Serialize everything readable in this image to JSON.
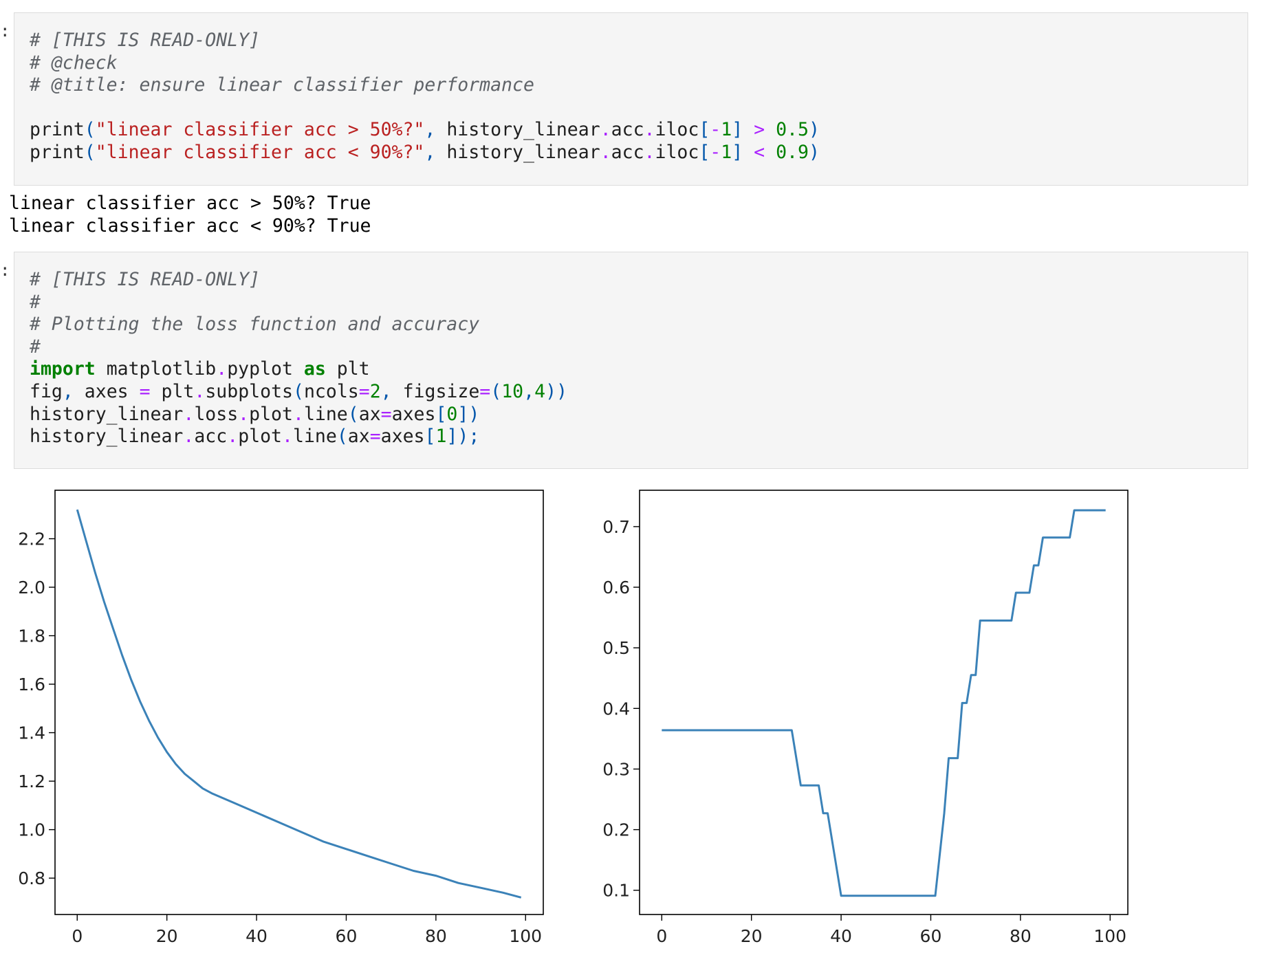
{
  "cells": [
    {
      "lines": [
        [
          {
            "t": "# [THIS IS READ-ONLY]",
            "c": "cm"
          }
        ],
        [
          {
            "t": "# @check",
            "c": "cm"
          }
        ],
        [
          {
            "t": "# @title: ensure linear classifier performance",
            "c": "cm"
          }
        ],
        [],
        [
          {
            "t": "print",
            "c": ""
          },
          {
            "t": "(",
            "c": "pun"
          },
          {
            "t": "\"linear classifier acc > 50%?\"",
            "c": "str"
          },
          {
            "t": ",",
            "c": "pun"
          },
          {
            "t": " history_linear",
            "c": ""
          },
          {
            "t": ".",
            "c": "op"
          },
          {
            "t": "acc",
            "c": ""
          },
          {
            "t": ".",
            "c": "op"
          },
          {
            "t": "iloc",
            "c": ""
          },
          {
            "t": "[",
            "c": "pun"
          },
          {
            "t": "-",
            "c": "op"
          },
          {
            "t": "1",
            "c": "num"
          },
          {
            "t": "]",
            "c": "pun"
          },
          {
            "t": " > ",
            "c": "op"
          },
          {
            "t": "0.5",
            "c": "num"
          },
          {
            "t": ")",
            "c": "pun"
          }
        ],
        [
          {
            "t": "print",
            "c": ""
          },
          {
            "t": "(",
            "c": "pun"
          },
          {
            "t": "\"linear classifier acc < 90%?\"",
            "c": "str"
          },
          {
            "t": ",",
            "c": "pun"
          },
          {
            "t": " history_linear",
            "c": ""
          },
          {
            "t": ".",
            "c": "op"
          },
          {
            "t": "acc",
            "c": ""
          },
          {
            "t": ".",
            "c": "op"
          },
          {
            "t": "iloc",
            "c": ""
          },
          {
            "t": "[",
            "c": "pun"
          },
          {
            "t": "-",
            "c": "op"
          },
          {
            "t": "1",
            "c": "num"
          },
          {
            "t": "]",
            "c": "pun"
          },
          {
            "t": " < ",
            "c": "op"
          },
          {
            "t": "0.9",
            "c": "num"
          },
          {
            "t": ")",
            "c": "pun"
          }
        ]
      ],
      "output": [
        "linear classifier acc > 50%? True",
        "linear classifier acc < 90%? True"
      ]
    },
    {
      "lines": [
        [
          {
            "t": "# [THIS IS READ-ONLY]",
            "c": "cm"
          }
        ],
        [
          {
            "t": "#",
            "c": "cm"
          }
        ],
        [
          {
            "t": "# Plotting the loss function and accuracy",
            "c": "cm"
          }
        ],
        [
          {
            "t": "#",
            "c": "cm"
          }
        ],
        [
          {
            "t": "import",
            "c": "kw"
          },
          {
            "t": " matplotlib",
            "c": ""
          },
          {
            "t": ".",
            "c": "op"
          },
          {
            "t": "pyplot ",
            "c": ""
          },
          {
            "t": "as",
            "c": "kw"
          },
          {
            "t": " plt",
            "c": ""
          }
        ],
        [
          {
            "t": "fig",
            "c": ""
          },
          {
            "t": ",",
            "c": "pun"
          },
          {
            "t": " axes ",
            "c": ""
          },
          {
            "t": "=",
            "c": "op"
          },
          {
            "t": " plt",
            "c": ""
          },
          {
            "t": ".",
            "c": "op"
          },
          {
            "t": "subplots",
            "c": ""
          },
          {
            "t": "(",
            "c": "pun"
          },
          {
            "t": "ncols",
            "c": ""
          },
          {
            "t": "=",
            "c": "op"
          },
          {
            "t": "2",
            "c": "num"
          },
          {
            "t": ",",
            "c": "pun"
          },
          {
            "t": " figsize",
            "c": ""
          },
          {
            "t": "=",
            "c": "op"
          },
          {
            "t": "(",
            "c": "pun"
          },
          {
            "t": "10",
            "c": "num"
          },
          {
            "t": ",",
            "c": "pun"
          },
          {
            "t": "4",
            "c": "num"
          },
          {
            "t": "))",
            "c": "pun"
          }
        ],
        [
          {
            "t": "history_linear",
            "c": ""
          },
          {
            "t": ".",
            "c": "op"
          },
          {
            "t": "loss",
            "c": ""
          },
          {
            "t": ".",
            "c": "op"
          },
          {
            "t": "plot",
            "c": ""
          },
          {
            "t": ".",
            "c": "op"
          },
          {
            "t": "line",
            "c": ""
          },
          {
            "t": "(",
            "c": "pun"
          },
          {
            "t": "ax",
            "c": ""
          },
          {
            "t": "=",
            "c": "op"
          },
          {
            "t": "axes",
            "c": ""
          },
          {
            "t": "[",
            "c": "pun"
          },
          {
            "t": "0",
            "c": "num"
          },
          {
            "t": "])",
            "c": "pun"
          }
        ],
        [
          {
            "t": "history_linear",
            "c": ""
          },
          {
            "t": ".",
            "c": "op"
          },
          {
            "t": "acc",
            "c": ""
          },
          {
            "t": ".",
            "c": "op"
          },
          {
            "t": "plot",
            "c": ""
          },
          {
            "t": ".",
            "c": "op"
          },
          {
            "t": "line",
            "c": ""
          },
          {
            "t": "(",
            "c": "pun"
          },
          {
            "t": "ax",
            "c": ""
          },
          {
            "t": "=",
            "c": "op"
          },
          {
            "t": "axes",
            "c": ""
          },
          {
            "t": "[",
            "c": "pun"
          },
          {
            "t": "1",
            "c": "num"
          },
          {
            "t": "]);",
            "c": "pun"
          }
        ]
      ]
    }
  ],
  "colors": {
    "line": "#3b82b8",
    "comment": "#5f6368",
    "string": "#ba2121",
    "number": "#008000",
    "operator": "#aa22ff",
    "keyword": "#008000"
  },
  "chart_data": [
    {
      "type": "line",
      "title": "",
      "xlabel": "",
      "ylabel": "",
      "xlim": [
        -4.95,
        103.95
      ],
      "ylim": [
        0.65,
        2.4
      ],
      "xticks": [
        0,
        20,
        40,
        60,
        80,
        100
      ],
      "yticks": [
        0.8,
        1.0,
        1.2,
        1.4,
        1.6,
        1.8,
        2.0,
        2.2
      ],
      "ytick_labels": [
        "0.8",
        "1.0",
        "1.2",
        "1.4",
        "1.6",
        "1.8",
        "2.0",
        "2.2"
      ],
      "grid": false,
      "series": [
        {
          "x": [
            0,
            2,
            4,
            6,
            8,
            10,
            12,
            14,
            16,
            18,
            20,
            22,
            24,
            26,
            28,
            30,
            35,
            40,
            45,
            50,
            55,
            60,
            65,
            70,
            75,
            80,
            85,
            90,
            95,
            99
          ],
          "values": [
            2.32,
            2.19,
            2.06,
            1.94,
            1.83,
            1.72,
            1.62,
            1.53,
            1.45,
            1.38,
            1.32,
            1.27,
            1.23,
            1.2,
            1.17,
            1.15,
            1.11,
            1.07,
            1.03,
            0.99,
            0.95,
            0.92,
            0.89,
            0.86,
            0.83,
            0.81,
            0.78,
            0.76,
            0.74,
            0.72
          ]
        }
      ]
    },
    {
      "type": "line",
      "title": "",
      "xlabel": "",
      "ylabel": "",
      "xlim": [
        -4.95,
        103.95
      ],
      "ylim": [
        0.06,
        0.76
      ],
      "xticks": [
        0,
        20,
        40,
        60,
        80,
        100
      ],
      "yticks": [
        0.1,
        0.2,
        0.3,
        0.4,
        0.5,
        0.6,
        0.7
      ],
      "ytick_labels": [
        "0.1",
        "0.2",
        "0.3",
        "0.4",
        "0.5",
        "0.6",
        "0.7"
      ],
      "grid": false,
      "series": [
        {
          "x": [
            0,
            29,
            31,
            35,
            36,
            37,
            40,
            61,
            63,
            64,
            65,
            66,
            67,
            68,
            69,
            70,
            71,
            73,
            78,
            79,
            80,
            82,
            83,
            84,
            85,
            91,
            92,
            99
          ],
          "values": [
            0.364,
            0.364,
            0.273,
            0.273,
            0.227,
            0.227,
            0.091,
            0.091,
            0.227,
            0.318,
            0.318,
            0.318,
            0.409,
            0.409,
            0.455,
            0.455,
            0.545,
            0.545,
            0.545,
            0.591,
            0.591,
            0.591,
            0.636,
            0.636,
            0.682,
            0.682,
            0.727,
            0.727
          ]
        }
      ]
    }
  ]
}
